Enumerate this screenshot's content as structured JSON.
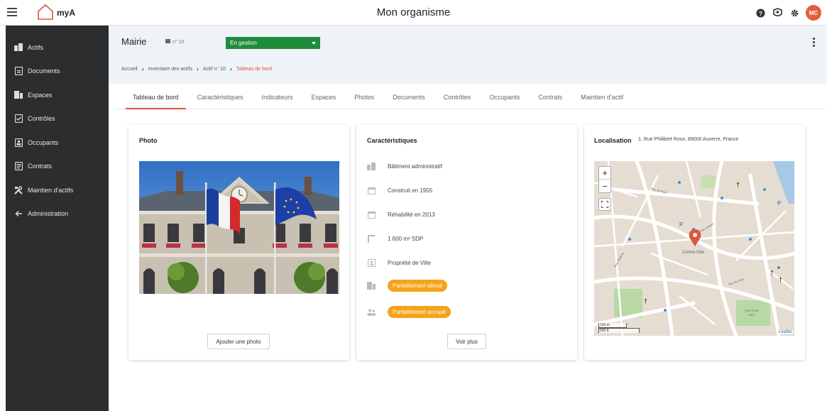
{
  "app": {
    "brand": "myA",
    "org_title": "Mon organisme",
    "user_initials": "MC",
    "accent": "#e0533b",
    "icons": [
      "menu-icon",
      "help-icon",
      "user-icon",
      "settings-icon"
    ]
  },
  "sidebar": {
    "items": [
      {
        "label": "Actifs",
        "icon": "building-icon"
      },
      {
        "label": "Documents",
        "icon": "document-icon"
      },
      {
        "label": "Espaces",
        "icon": "spaces-icon"
      },
      {
        "label": "Contrôles",
        "icon": "checklist-icon"
      },
      {
        "label": "Occupants",
        "icon": "occupant-icon"
      },
      {
        "label": "Contrats",
        "icon": "contract-icon"
      },
      {
        "label": "Maintien d'actifs",
        "icon": "tools-icon"
      },
      {
        "label": "Administration",
        "icon": "arrow-left-icon"
      }
    ]
  },
  "header": {
    "asset_title": "Mairie",
    "asset_number": "n° 10",
    "status": "En gestion",
    "status_color": "#1f8c3c",
    "breadcrumb": [
      "Accueil",
      "Inventaire des actifs",
      "Actif n° 10",
      "Tableau de bord"
    ]
  },
  "tabs": [
    {
      "label": "Tableau de bord",
      "active": true
    },
    {
      "label": "Caractéristiques"
    },
    {
      "label": "Indicateurs"
    },
    {
      "label": "Espaces"
    },
    {
      "label": "Photos"
    },
    {
      "label": "Documents"
    },
    {
      "label": "Contrôles"
    },
    {
      "label": "Occupants"
    },
    {
      "label": "Contrats"
    },
    {
      "label": "Maintien d'actif"
    }
  ],
  "photo_card": {
    "title": "Photo",
    "button": "Ajouter une photo"
  },
  "char_card": {
    "title": "Caractéristiques",
    "rows": [
      {
        "label": "Bâtiment administratif",
        "icon": "building-icon"
      },
      {
        "label": "Construit en 1955",
        "icon": "calendar-icon"
      },
      {
        "label": "Réhabilité en 2013",
        "icon": "calendar-icon"
      },
      {
        "label": "1 600 m² SDP",
        "icon": "area-icon"
      },
      {
        "label": "Propriété de Ville",
        "icon": "owner-icon"
      }
    ],
    "alloc_status": "Partiellement alloué",
    "occup_status": "Partiellement occupé",
    "pill_color": "#f5a31a",
    "button": "Voir plus"
  },
  "loc_card": {
    "title": "Localisation",
    "address": "1, Rue Philibert Roux, 89000 Auxerre, France",
    "marker_label": "Centre-Ville",
    "scale_m": "100 m",
    "scale_ft": "500 ft",
    "attribution": "Leaflet"
  }
}
